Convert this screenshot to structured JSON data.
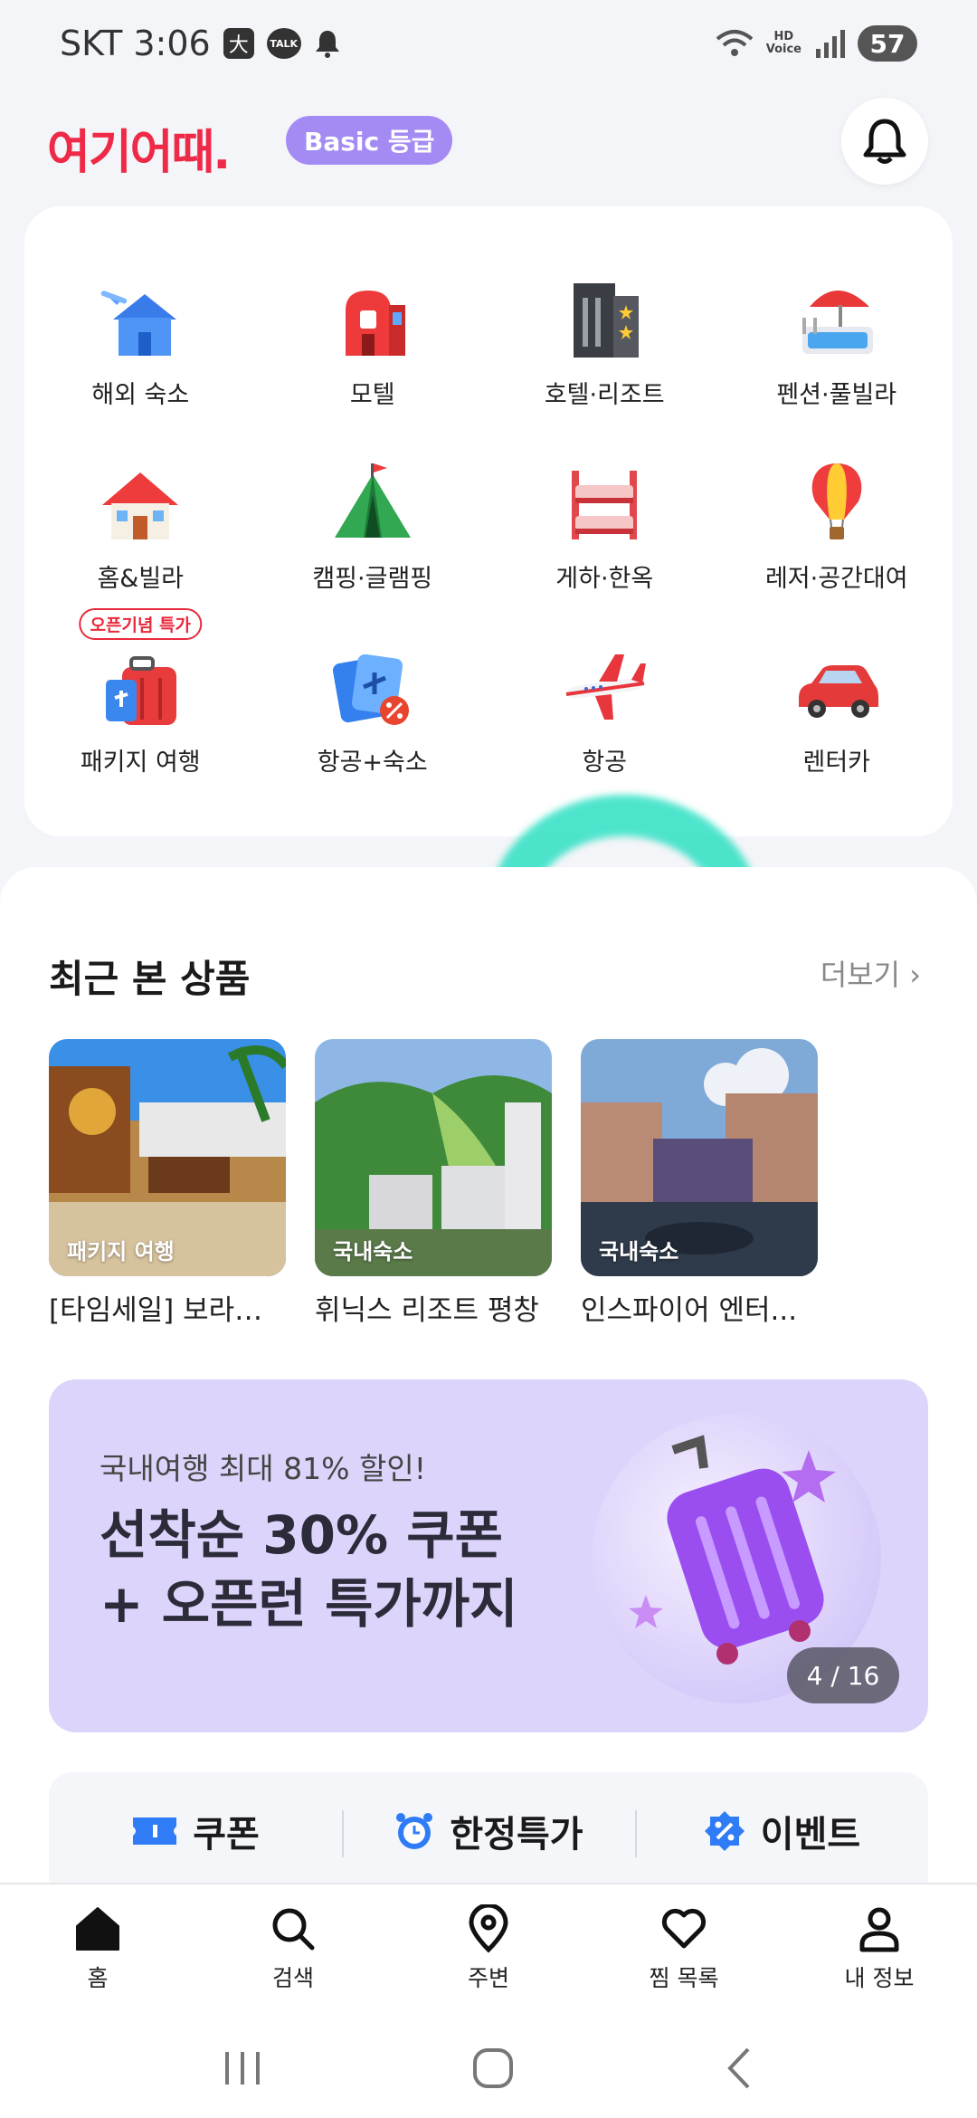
{
  "status_bar": {
    "carrier_time": "SKT 3:06",
    "chip": "大",
    "talk": "TALK",
    "hd": "HD",
    "voice": "Voice",
    "battery": "57"
  },
  "header": {
    "logo": "여기어때.",
    "grade": "Basic 등급"
  },
  "categories": [
    {
      "label": "해외 숙소",
      "icon": "overseas-house-icon"
    },
    {
      "label": "모텔",
      "icon": "motel-icon"
    },
    {
      "label": "호텔·리조트",
      "icon": "hotel-icon"
    },
    {
      "label": "펜션·풀빌라",
      "icon": "pool-villa-icon"
    },
    {
      "label": "홈&빌라",
      "icon": "home-icon"
    },
    {
      "label": "캠핑·글램핑",
      "icon": "tent-icon"
    },
    {
      "label": "게하·한옥",
      "icon": "bunkbed-icon"
    },
    {
      "label": "레저·공간대여",
      "icon": "balloon-icon"
    },
    {
      "label": "패키지 여행",
      "icon": "suitcase-icon",
      "badge": "오픈기념 특가"
    },
    {
      "label": "항공+숙소",
      "icon": "flight-hotel-icon"
    },
    {
      "label": "항공",
      "icon": "airplane-icon"
    },
    {
      "label": "렌터카",
      "icon": "car-icon"
    }
  ],
  "recent": {
    "title": "최근 본 상품",
    "more": "더보기",
    "items": [
      {
        "tag": "패키지 여행",
        "title": "[타임세일] 보라카..."
      },
      {
        "tag": "국내숙소",
        "title": "휘닉스 리조트 평창"
      },
      {
        "tag": "국내숙소",
        "title": "인스파이어 엔터..."
      }
    ]
  },
  "banner": {
    "subtitle": "국내여행 최대 81% 할인!",
    "title_line1": "선착순 30% 쿠폰",
    "title_line2": "+ 오픈런 특가까지",
    "page": "4 / 16"
  },
  "quick_links": [
    {
      "label": "쿠폰",
      "icon": "ticket-icon"
    },
    {
      "label": "한정특가",
      "icon": "alarm-icon"
    },
    {
      "label": "이벤트",
      "icon": "percent-badge-icon"
    }
  ],
  "bottom_nav": [
    {
      "label": "홈",
      "icon": "home-nav-icon"
    },
    {
      "label": "검색",
      "icon": "search-icon"
    },
    {
      "label": "주변",
      "icon": "location-pin-icon"
    },
    {
      "label": "찜 목록",
      "icon": "heart-icon"
    },
    {
      "label": "내 정보",
      "icon": "person-icon"
    }
  ],
  "colors": {
    "brand": "#ef2a48",
    "grade": "#a48bf4",
    "accent_blue": "#2f7cf6",
    "highlight": "#2fe0c4",
    "banner_bg": "#ddd4fb"
  }
}
